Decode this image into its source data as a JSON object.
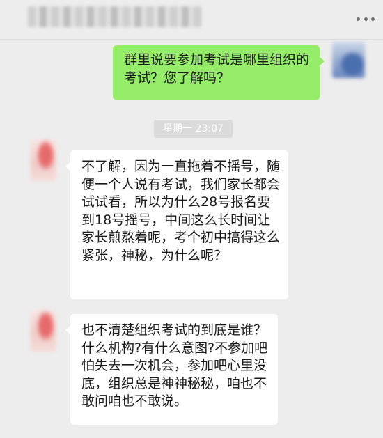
{
  "header": {
    "title": "",
    "more_icon": "more-dots-icon"
  },
  "messages": [
    {
      "side": "self",
      "text": "群里说要参加考试是哪里组织的考试？您了解吗？"
    },
    {
      "side": "other",
      "text": "不了解，因为一直拖着不摇号，随便一个人说有考试，我们家长都会试试看，所以为什么28号报名要到18号摇号，中间这么长时间让家长煎熬着呢，考个初中搞得这么紧张，神秘，为什么呢？"
    },
    {
      "side": "other",
      "text": "也不清楚组织考试的到底是谁？什么机构?有什么意图?不参加吧怕失去一次机会，参加吧心里没底，组织总是神神秘秘，咱也不敢问咱也不敢说。"
    }
  ],
  "timestamp": "星期一 23:07",
  "colors": {
    "background": "#ededed",
    "self_bubble": "#95ec69",
    "other_bubble": "#ffffff",
    "timestamp_bg": "#dadada"
  }
}
